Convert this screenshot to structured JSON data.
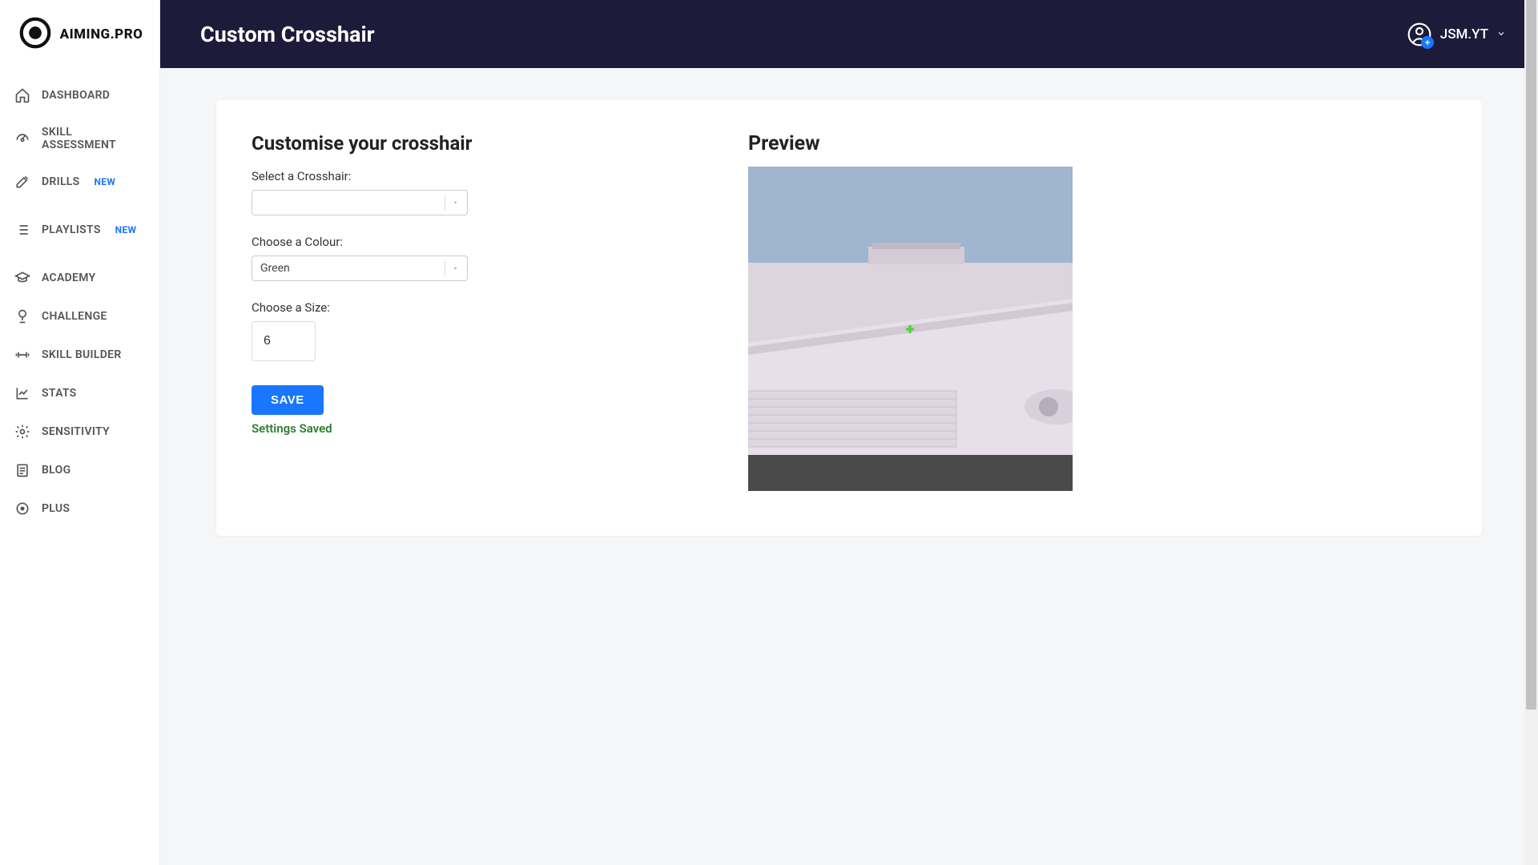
{
  "brand": {
    "name": "AIMING.PRO"
  },
  "header": {
    "title": "Custom Crosshair",
    "user_name": "JSM.YT"
  },
  "sidebar": {
    "items": [
      {
        "label": "DASHBOARD",
        "icon": "home",
        "badge": ""
      },
      {
        "label": "SKILL ASSESSMENT",
        "icon": "gauge",
        "badge": ""
      },
      {
        "label": "DRILLS",
        "icon": "tools",
        "badge": "NEW"
      },
      {
        "label": "PLAYLISTS",
        "icon": "list",
        "badge": "NEW"
      },
      {
        "label": "ACADEMY",
        "icon": "grad-cap",
        "badge": ""
      },
      {
        "label": "CHALLENGE",
        "icon": "trophy",
        "badge": ""
      },
      {
        "label": "SKILL BUILDER",
        "icon": "barbell",
        "badge": ""
      },
      {
        "label": "STATS",
        "icon": "chart",
        "badge": ""
      },
      {
        "label": "SENSITIVITY",
        "icon": "gear",
        "badge": ""
      },
      {
        "label": "BLOG",
        "icon": "doc",
        "badge": ""
      },
      {
        "label": "PLUS",
        "icon": "target",
        "badge": ""
      }
    ]
  },
  "form": {
    "heading": "Customise your crosshair",
    "crosshair_label": "Select a Crosshair:",
    "crosshair_value": "",
    "colour_label": "Choose a Colour:",
    "colour_value": "Green",
    "size_label": "Choose a Size:",
    "size_value": "6",
    "save_label": "SAVE",
    "status_text": "Settings Saved"
  },
  "preview": {
    "heading": "Preview",
    "crosshair_color": "#3fd92b"
  }
}
